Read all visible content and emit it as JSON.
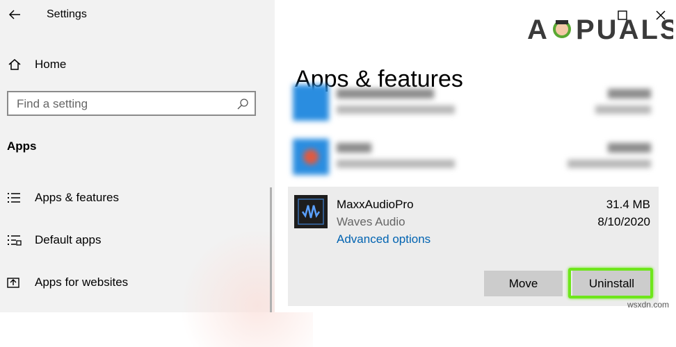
{
  "window": {
    "title": "Settings"
  },
  "sidebar": {
    "home_label": "Home",
    "search_placeholder": "Find a setting",
    "section_title": "Apps",
    "items": [
      {
        "label": "Apps & features",
        "icon": "list-icon"
      },
      {
        "label": "Default apps",
        "icon": "default-apps-icon"
      },
      {
        "label": "Apps for websites",
        "icon": "open-external-icon"
      }
    ]
  },
  "logo": {
    "text": "APPUALS"
  },
  "main": {
    "page_title": "Apps & features",
    "selected_app": {
      "name": "MaxxAudioPro",
      "publisher": "Waves Audio",
      "size": "31.4 MB",
      "date": "8/10/2020",
      "link_label": "Advanced options",
      "move_label": "Move",
      "uninstall_label": "Uninstall"
    }
  },
  "watermark": "wsxdn.com",
  "colors": {
    "accent": "#0063b1",
    "highlight": "#6ee61b",
    "sidebar_bg": "#f2f2f2"
  }
}
